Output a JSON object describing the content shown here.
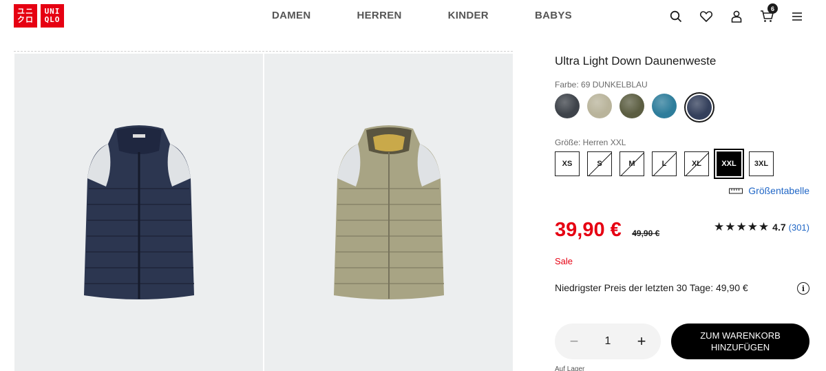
{
  "brand": {
    "logo_left": [
      "ユニ",
      "クロ"
    ],
    "logo_right": [
      "UNI",
      "QLO"
    ],
    "color": "#e60012"
  },
  "nav": [
    "DAMEN",
    "HERREN",
    "KINDER",
    "BABYS"
  ],
  "header_icons": [
    "search-icon",
    "heart-icon",
    "user-icon",
    "cart-icon",
    "menu-icon"
  ],
  "cart_count": "6",
  "product": {
    "title": "Ultra Light Down Daunenweste",
    "color_label": "Farbe: 69 DUNKELBLAU",
    "swatches": [
      {
        "name": "dunkelgrau",
        "color": "#3e434a"
      },
      {
        "name": "beige",
        "color": "#b9b49b"
      },
      {
        "name": "olive",
        "color": "#5c5e42"
      },
      {
        "name": "blau",
        "color": "#2e7d9b"
      },
      {
        "name": "dunkelblau",
        "color": "#34405c",
        "selected": true
      }
    ],
    "size_label": "Größe: Herren XXL",
    "sizes": [
      {
        "label": "XS",
        "state": "available"
      },
      {
        "label": "S",
        "state": "disabled"
      },
      {
        "label": "M",
        "state": "disabled"
      },
      {
        "label": "L",
        "state": "disabled"
      },
      {
        "label": "XL",
        "state": "disabled"
      },
      {
        "label": "XXL",
        "state": "selected"
      },
      {
        "label": "3XL",
        "state": "available"
      }
    ],
    "size_chart_label": "Größentabelle",
    "price": "39,90 €",
    "old_price": "49,90 €",
    "stars": "★★★★★",
    "rating": "4.7",
    "review_count": "(301)",
    "sale_label": "Sale",
    "lowest_price_text": "Niedrigster Preis der letzten 30 Tage: 49,90 €",
    "quantity": "1",
    "minus": "−",
    "plus": "+",
    "add_to_cart": "ZUM WARENKORB HINZUFÜGEN",
    "stock": "Auf Lager"
  },
  "gallery": [
    {
      "name": "vest-navy",
      "color": "#2c3650"
    },
    {
      "name": "vest-beige",
      "color": "#a8a484"
    }
  ]
}
